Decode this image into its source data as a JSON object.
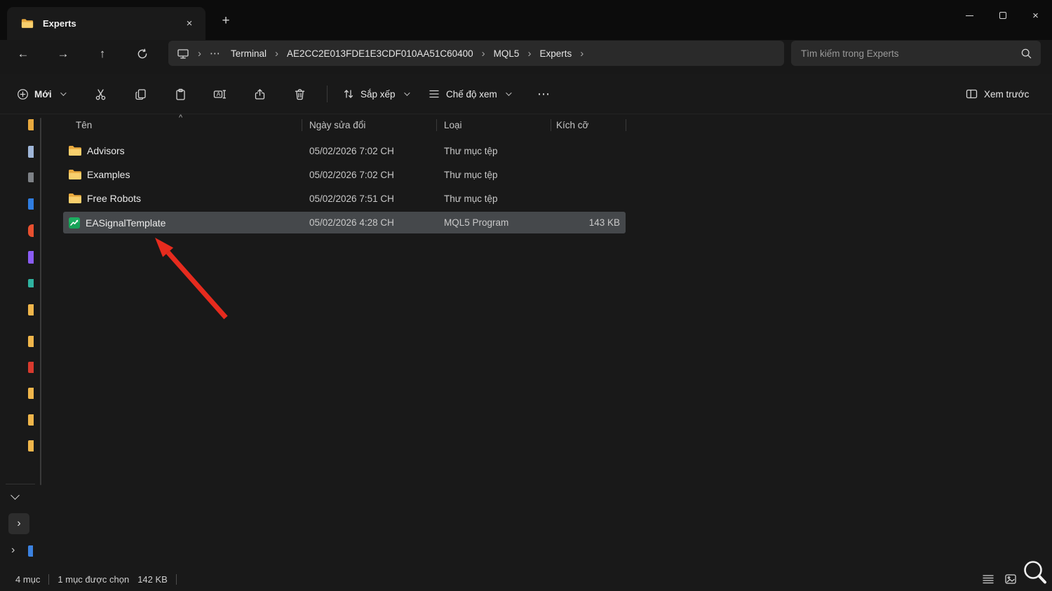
{
  "icons": {
    "back": "←",
    "forward": "→",
    "up": "↑",
    "chevron": "›",
    "overflow": "⋯",
    "more": "⋯",
    "tab_close": "×",
    "close": "×",
    "plus": "+",
    "sort_caret": "^"
  },
  "window": {
    "tab_title": "Experts"
  },
  "address": {
    "crumbs": [
      "Terminal",
      "AE2CC2E013FDE1E3CDF010AA51C60400",
      "MQL5",
      "Experts"
    ]
  },
  "search": {
    "placeholder": "Tìm kiếm trong Experts"
  },
  "toolbar": {
    "new": "Mới",
    "sort": "Sắp xếp",
    "view": "Chế độ xem",
    "preview": "Xem trước"
  },
  "columns": {
    "name": "Tên",
    "date": "Ngày sửa đổi",
    "type": "Loại",
    "size": "Kích cỡ"
  },
  "rows": [
    {
      "name": "Advisors",
      "date": "05/02/2026 7:02 CH",
      "type": "Thư mục tệp",
      "size": ""
    },
    {
      "name": "Examples",
      "date": "05/02/2026 7:02 CH",
      "type": "Thư mục tệp",
      "size": ""
    },
    {
      "name": "Free Robots",
      "date": "05/02/2026 7:51 CH",
      "type": "Thư mục tệp",
      "size": ""
    },
    {
      "name": "EASignalTemplate",
      "date": "05/02/2026 4:28 CH",
      "type": "MQL5 Program",
      "size": "143 KB"
    }
  ],
  "status": {
    "count": "4 mục",
    "selected": "1 mục được chọn",
    "size": "142 KB"
  },
  "colors": {
    "accent_red": "#e62b1e",
    "folder_yellow": "#f8cf6d",
    "mql5_green": "#16a157",
    "selection": "#45484b"
  }
}
